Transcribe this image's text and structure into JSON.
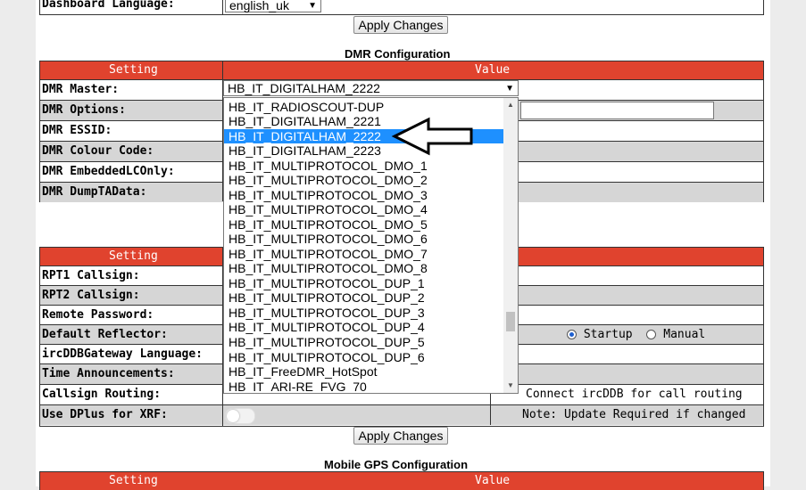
{
  "top": {
    "dashboard_language_label": "Dashboard Language:",
    "language_value": "english_uk",
    "apply_button": "Apply Changes"
  },
  "dmr": {
    "title": "DMR Configuration",
    "header_setting": "Setting",
    "header_value": "Value",
    "rows": [
      "DMR Master:",
      "DMR Options:",
      "DMR ESSID:",
      "DMR Colour Code:",
      "DMR EmbeddedLCOnly:",
      "DMR DumpTAData:"
    ],
    "master_selected": "HB_IT_DIGITALHAM_2222"
  },
  "dropdown": {
    "options": [
      "HB_IT_RADIOSCOUT-DUP",
      "HB_IT_DIGITALHAM_2221",
      "HB_IT_DIGITALHAM_2222",
      "HB_IT_DIGITALHAM_2223",
      "HB_IT_MULTIPROTOCOL_DMO_1",
      "HB_IT_MULTIPROTOCOL_DMO_2",
      "HB_IT_MULTIPROTOCOL_DMO_3",
      "HB_IT_MULTIPROTOCOL_DMO_4",
      "HB_IT_MULTIPROTOCOL_DMO_5",
      "HB_IT_MULTIPROTOCOL_DMO_6",
      "HB_IT_MULTIPROTOCOL_DMO_7",
      "HB_IT_MULTIPROTOCOL_DMO_8",
      "HB_IT_MULTIPROTOCOL_DUP_1",
      "HB_IT_MULTIPROTOCOL_DUP_2",
      "HB_IT_MULTIPROTOCOL_DUP_3",
      "HB_IT_MULTIPROTOCOL_DUP_4",
      "HB_IT_MULTIPROTOCOL_DUP_5",
      "HB_IT_MULTIPROTOCOL_DUP_6",
      "HB_IT_FreeDMR_HotSpot",
      "HB_IT_ARI-RE_FVG_70"
    ],
    "selected_index": 2
  },
  "dstar": {
    "header_setting": "Setting",
    "rows": [
      "RPT1 Callsign:",
      "RPT2 Callsign:",
      "Remote Password:",
      "Default Reflector:",
      "ircDDBGateway Language:",
      "Time Announcements:",
      "Callsign Routing:",
      "Use DPlus for XRF:"
    ],
    "startup_label": "Startup",
    "manual_label": "Manual",
    "callsign_routing_note": "Connect ircDDB for call routing",
    "dplus_note": "Note: Update Required if changed",
    "apply_button": "Apply Changes"
  },
  "gps": {
    "title": "Mobile GPS Configuration",
    "header_setting": "Setting",
    "header_value": "Value"
  },
  "colors": {
    "header_red": "#e0432e",
    "selection_blue": "#1e90ff"
  }
}
